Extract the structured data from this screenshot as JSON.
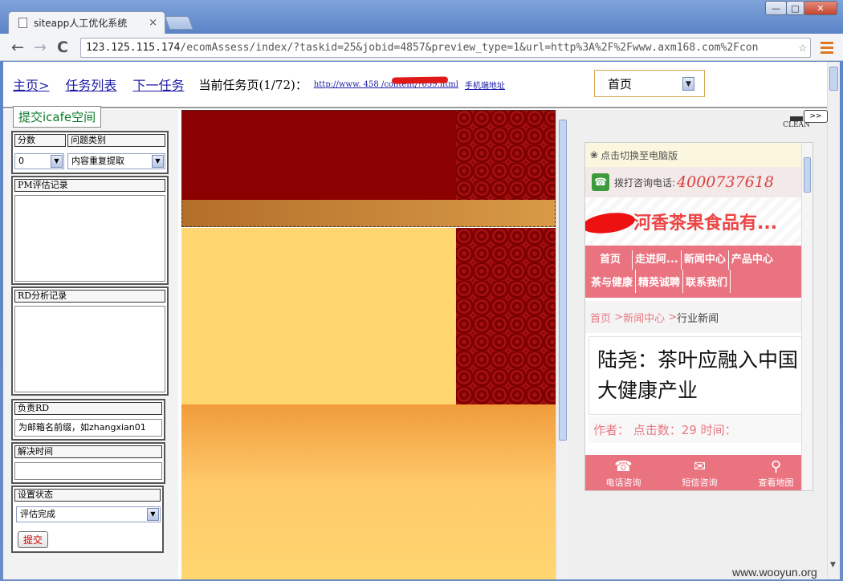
{
  "window": {
    "tab_title": "siteapp人工优化系统",
    "tab_close": "×",
    "controls": {
      "minimize": "—",
      "maximize": "□",
      "close": "✕"
    }
  },
  "toolbar": {
    "back": "←",
    "forward": "→",
    "reload": "C",
    "url_host": "123.125.115.174",
    "url_rest": "/ecomAssess/index/?taskid=25&jobid=4857&preview_type=1&url=http%3A%2F%2Fwww.axm168.com%2Fcon",
    "star": "☆"
  },
  "topbar": {
    "home_link": "主页>",
    "task_list_link": "任务列表",
    "next_task_link": "下一任务",
    "current_task": "当前任务页(1/72)：",
    "page_url": "http://www.        458      /content/?659.html",
    "mobile_link": "手机端地址",
    "page_select": "首页"
  },
  "left_panel": {
    "submit_icafe": "提交icafe空间",
    "score_label": "分数",
    "issue_type_label": "问题类别",
    "score_value": "0",
    "issue_type_value": "内容重复提取",
    "pm_label": "PM评估记录",
    "rd_label": "RD分析记录",
    "owner_label": "负责RD",
    "owner_placeholder": "为邮箱名前缀，如zhangxian01",
    "resolve_time_label": "解决时间",
    "status_label": "设置状态",
    "status_value": "评估完成",
    "submit_button": "提交"
  },
  "mobile": {
    "clean_label": "CLEAN",
    "expand_button": ">>",
    "switch_pc": "点击切换至电脑版",
    "call_label": "拨打咨询电话:",
    "phone": "4000737618",
    "brand": "河香茶果食品有...",
    "nav": [
      "首页",
      "走进阿...",
      "新闻中心",
      "产品中心",
      "茶与健康",
      "精英诚聘",
      "联系我们"
    ],
    "crumb_home": "首页",
    "crumb_sep": ">",
    "crumb_news": "新闻中心",
    "crumb_current": "行业新闻",
    "article_title": "陆尧：茶叶应融入中国大健康产业",
    "meta": "作者：  点击数：29 时间：",
    "footer": [
      {
        "icon": "phone-icon",
        "glyph": "☎",
        "label": "电话咨询"
      },
      {
        "icon": "mail-icon",
        "glyph": "✉",
        "label": "短信咨询"
      },
      {
        "icon": "map-pin-icon",
        "glyph": "⚲",
        "label": "查看地图"
      }
    ]
  },
  "watermark": "www.wooyun.org",
  "colors": {
    "preview_dark_red": "#8b0000",
    "preview_band": "#b8772d",
    "preview_yellow": "#ffd670",
    "preview_orange": "#f09b3a",
    "mobile_accent": "#ea7380"
  }
}
